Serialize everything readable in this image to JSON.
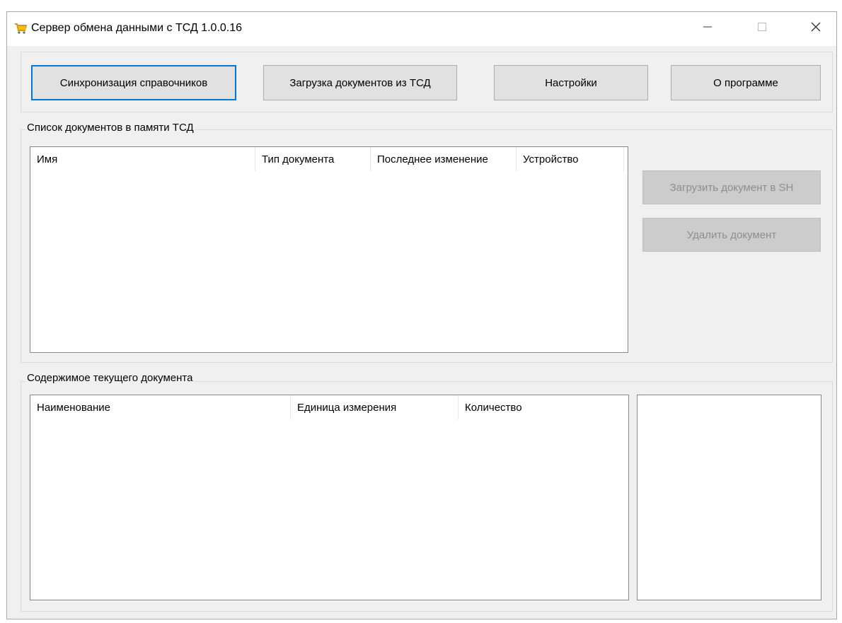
{
  "window": {
    "title": "Сервер обмена данными с ТСД 1.0.0.16"
  },
  "toolbar": {
    "sync_label": "Синхронизация справочников",
    "upload_label": "Загрузка документов из ТСД",
    "settings_label": "Настройки",
    "about_label": "О программе"
  },
  "documents": {
    "group_title": "Список документов в памяти ТСД",
    "columns": [
      "Имя",
      "Тип документа",
      "Последнее изменение",
      "Устройство"
    ],
    "rows": [],
    "load_to_sh_label": "Загрузить документ в SH",
    "delete_label": "Удалить документ"
  },
  "contents": {
    "group_title": "Содержимое текущего документа",
    "columns": [
      "Наименование",
      "Единица измерения",
      "Количество"
    ],
    "rows": []
  },
  "icons": {
    "app": "shopping-cart-icon",
    "minimize": "minimize-icon",
    "maximize": "maximize-icon",
    "close": "close-icon"
  },
  "colors": {
    "focus_border": "#0078d7",
    "cart_icon": "#e0a800"
  }
}
